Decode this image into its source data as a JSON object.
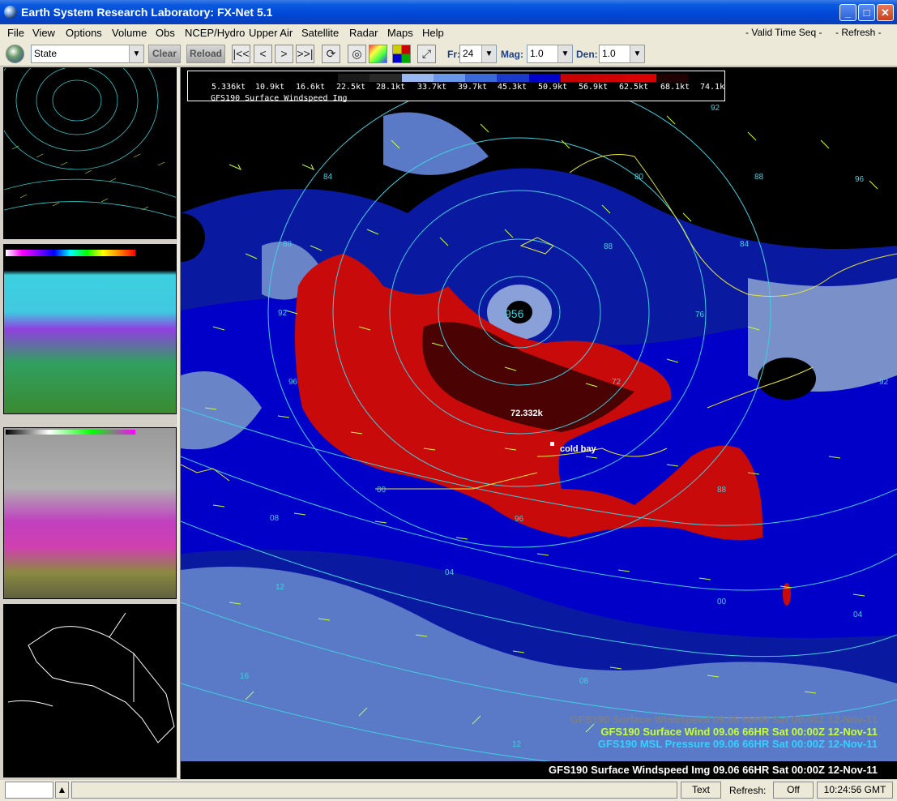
{
  "window": {
    "title": "Earth System Research Laboratory: FX-Net 5.1",
    "minimize": "_",
    "maximize": "□",
    "close": "✕"
  },
  "menubar": {
    "items": [
      "File",
      "View",
      "Options",
      "Volume",
      "Obs",
      "NCEP/Hydro",
      "Upper Air",
      "Satellite",
      "Radar",
      "Maps",
      "Help"
    ],
    "valid_time_seq": "- Valid Time Seq -",
    "refresh": "- Refresh -"
  },
  "toolbar": {
    "scale_select": "State",
    "clear_label": "Clear",
    "reload_label": "Reload",
    "fr_label": "Fr:",
    "fr_value": "24",
    "mag_label": "Mag:",
    "mag_value": "1.0",
    "den_label": "Den:",
    "den_value": "1.0",
    "icons": [
      "globe-icon",
      "first-frame-icon",
      "prev-frame-icon",
      "next-frame-icon",
      "last-frame-icon",
      "loop-icon",
      "rock-icon",
      "color-table-icon",
      "sample-icon",
      "zoom-icon"
    ]
  },
  "legend": {
    "labels": [
      "5.336kt",
      "10.9kt",
      "16.6kt",
      "22.5kt",
      "28.1kt",
      "33.7kt",
      "39.7kt",
      "45.3kt",
      "50.9kt",
      "56.9kt",
      "62.5kt",
      "68.1kt",
      "74.1kt"
    ],
    "colors": [
      "#000000",
      "#1a1a1a",
      "#2a2a2a",
      "#9ab8f0",
      "#6a98e8",
      "#3a6ad8",
      "#1a3acc",
      "#0000c8",
      "#c80000",
      "#d00000",
      "#d80000",
      "#200000",
      "#000000"
    ],
    "title": "GFS190 Surface Windspeed Img"
  },
  "map": {
    "low_center": "956",
    "max_label": "72.332k",
    "station": "cold bay",
    "contour_labels": [
      "84",
      "80",
      "88",
      "88",
      "96",
      "92",
      "92",
      "96",
      "84",
      "76",
      "72",
      "88",
      "88",
      "00",
      "96",
      "00",
      "08",
      "04",
      "04",
      "12",
      "16",
      "12",
      "08",
      "92",
      "96",
      "88",
      "04",
      "08"
    ]
  },
  "overlays": [
    {
      "text": "GFS190 Surface Windspeed  09.06  66HR Sat 00:00Z 12-Nov-11",
      "color": "#808080"
    },
    {
      "text": "GFS190 Surface Wind  09.06  66HR Sat 00:00Z 12-Nov-11",
      "color": "#c8ff32"
    },
    {
      "text": "GFS190 MSL Pressure  09.06  66HR Sat 00:00Z 12-Nov-11",
      "color": "#32d2ff"
    }
  ],
  "bottom_caption": "GFS190 Surface Windspeed Img 09.06  66HR Sat 00:00Z 12-Nov-11",
  "statusbar": {
    "text_label": "Text",
    "refresh_label": "Refresh:",
    "refresh_value": "Off",
    "time": "10:24:56 GMT"
  }
}
